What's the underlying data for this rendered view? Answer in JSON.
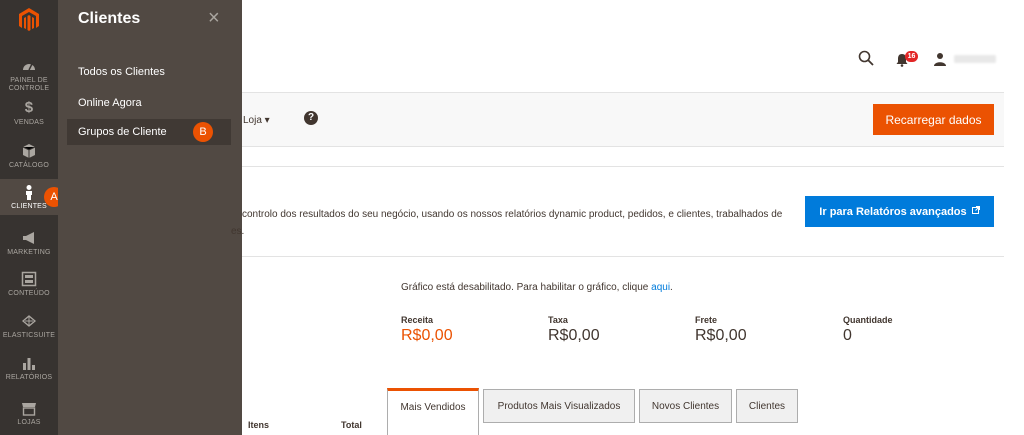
{
  "nav": {
    "items": [
      {
        "label": "PAINEL DE CONTROLE",
        "icon": "dashboard-icon"
      },
      {
        "label": "VENDAS",
        "icon": "dollar-icon"
      },
      {
        "label": "CATÁLOGO",
        "icon": "box-icon"
      },
      {
        "label": "CLIENTES",
        "icon": "person-icon"
      },
      {
        "label": "MARKETING",
        "icon": "megaphone-icon"
      },
      {
        "label": "CONTEÚDO",
        "icon": "layout-icon"
      },
      {
        "label": "ELASTICSUITE",
        "icon": "elasticsuite-icon"
      },
      {
        "label": "RELATÓRIOS",
        "icon": "bar-chart-icon"
      },
      {
        "label": "LOJAS",
        "icon": "store-icon"
      }
    ]
  },
  "flyout": {
    "title": "Clientes",
    "close": "×",
    "items": [
      "Todos os Clientes",
      "Online Agora",
      "Grupos de Cliente"
    ]
  },
  "callouts": {
    "a": "A",
    "b": "B"
  },
  "header": {
    "notifications_count": "16"
  },
  "toolbar": {
    "store_label": "Loja ▾",
    "help": "?",
    "reload_label": "Recarregar dados"
  },
  "intro": {
    "text_line1": "controlo dos resultados do seu negócio, usando os nossos relatórios dynamic product, pedidos, e clientes, trabalhados de",
    "text_line2": "es.",
    "advanced_button": "Ir para Relatóros avançados"
  },
  "chart": {
    "note_prefix": "Gráfico está desabilitado. Para habilitar o gráfico, clique ",
    "note_link": "aqui",
    "note_suffix": "."
  },
  "stats": [
    {
      "label": "Receita",
      "value": "R$0,00"
    },
    {
      "label": "Taxa",
      "value": "R$0,00"
    },
    {
      "label": "Frete",
      "value": "R$0,00"
    },
    {
      "label": "Quantidade",
      "value": "0"
    }
  ],
  "tabs": [
    "Mais Vendidos",
    "Produtos Mais Visualizados",
    "Novos Clientes",
    "Clientes"
  ],
  "table_headers": [
    "Itens",
    "Total"
  ],
  "colors": {
    "accent": "#eb5202",
    "link": "#007bdb",
    "nav_bg": "#373330",
    "flyout_bg": "#514943"
  }
}
